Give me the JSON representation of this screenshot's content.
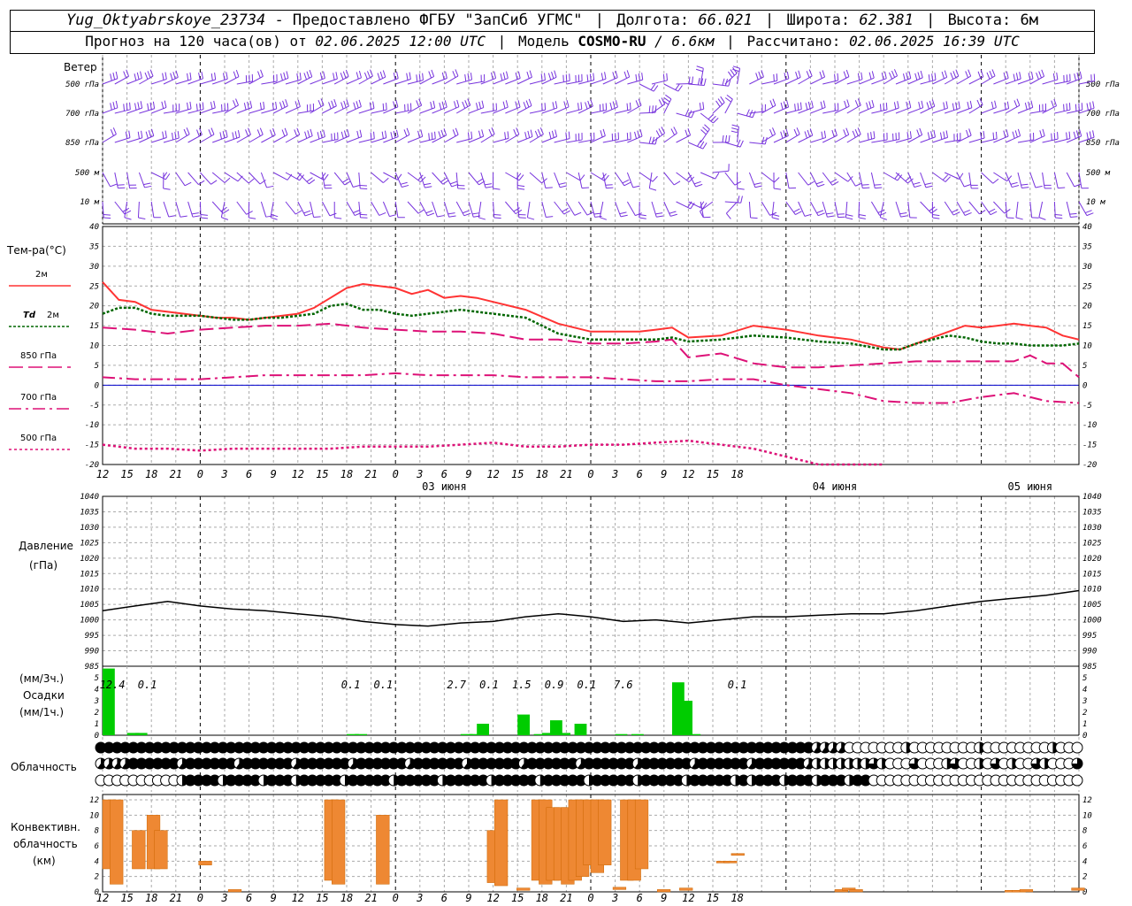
{
  "header": {
    "station": "Yug_Oktyabrskoye_23734",
    "provider": "- Предоставлено ФГБУ \"ЗапСиб УГМС\"",
    "lon_label": "Долгота:",
    "lon_value": "66.021",
    "lat_label": "Широта:",
    "lat_value": "62.381",
    "alt_label": "Высота:",
    "alt_value": "6м",
    "forecast_label": "Прогноз на 120 часа(ов) от",
    "forecast_time": "02.06.2025 12:00 UTC",
    "model_label": "Модель",
    "model_name": "COSMO-RU",
    "model_res": "/ 6.6км",
    "calc_label": "Рассчитано:",
    "calc_time": "02.06.2025 16:39 UTC"
  },
  "labels": {
    "wind": "Ветер",
    "temp": "Тем-ра(°С)",
    "t2m": "2м",
    "td": "Td",
    "td_level": "2м",
    "t850": "850 гПа",
    "t700": "700 гПа",
    "t500": "500 гПа",
    "pressure": "Давление",
    "pressure_unit": "(гПа)",
    "precip_unit3": "(мм/3ч.)",
    "precip": "Осадки",
    "precip_unit1": "(мм/1ч.)",
    "cloud": "Облачность",
    "conv1": "Конвективн.",
    "conv2": "облачность",
    "conv3": "(км)"
  },
  "colors": {
    "t2m": "#ff3333",
    "td": "#006600",
    "t850": "#dd1177",
    "t700": "#dd1177",
    "t500": "#dd1177",
    "wind": "#7733dd",
    "precip": "#00cc00",
    "conv": "#ee8833",
    "zero_line": "#0000cc"
  },
  "chart_data": [
    {
      "type": "wind_barbs",
      "levels": [
        "500 гПа",
        "700 гПа",
        "850 гПа",
        "500 м",
        "10 м"
      ],
      "x_hours": [
        0,
        120
      ]
    },
    {
      "type": "line",
      "ylabel": "Тем-ра(°С)",
      "ylim": [
        -20,
        40
      ],
      "yticks": [
        -20,
        -15,
        -10,
        -5,
        0,
        5,
        10,
        15,
        20,
        25,
        30,
        35,
        40
      ],
      "x_hour_ticks": [
        "12",
        "15",
        "18",
        "21",
        "0",
        "3",
        "6",
        "9",
        "12",
        "15",
        "18",
        "21",
        "0",
        "3",
        "6",
        "9",
        "12",
        "15",
        "18",
        "21",
        "0",
        "3",
        "6",
        "9",
        "12",
        "15",
        "18"
      ],
      "date_labels": [
        "03 июня",
        "04 июня",
        "05 июня"
      ],
      "series": [
        {
          "name": "2м",
          "x": [
            0,
            2,
            4,
            6,
            8,
            10,
            12,
            14,
            16,
            18,
            20,
            22,
            24,
            26,
            28,
            30,
            32,
            34,
            36,
            38,
            40,
            42,
            44,
            46,
            48,
            52,
            56,
            60,
            64,
            66,
            68,
            70,
            72,
            76,
            80,
            84,
            88,
            92,
            96,
            98,
            100,
            102,
            104,
            106,
            108,
            110,
            112,
            114,
            116,
            118,
            120
          ],
          "values": [
            26,
            21.5,
            21,
            19,
            18.5,
            18,
            17.5,
            17,
            17,
            16.5,
            17,
            17.5,
            18,
            19.5,
            22,
            24.5,
            25.5,
            25,
            24.5,
            23,
            24,
            22,
            22.5,
            22,
            21,
            19,
            15.5,
            13.5,
            13.5,
            13.5,
            14,
            14.5,
            12,
            12.5,
            15,
            14,
            12.5,
            11.5,
            9.5,
            9,
            10.5,
            12,
            13.5,
            15,
            14.5,
            15,
            15.5,
            15,
            14.5,
            12.5,
            11.5
          ]
        },
        {
          "name": "Td 2м",
          "x": [
            0,
            2,
            4,
            6,
            8,
            10,
            12,
            14,
            16,
            18,
            20,
            22,
            24,
            26,
            28,
            30,
            32,
            34,
            36,
            38,
            40,
            42,
            44,
            46,
            48,
            52,
            56,
            60,
            64,
            66,
            68,
            70,
            72,
            76,
            80,
            84,
            88,
            92,
            96,
            98,
            100,
            102,
            104,
            106,
            108,
            110,
            112,
            114,
            116,
            118,
            120
          ],
          "values": [
            18,
            19.5,
            19.5,
            18,
            17.5,
            17.5,
            17.5,
            17,
            16.5,
            16.5,
            17,
            17,
            17.5,
            18,
            20,
            20.5,
            19,
            19,
            18,
            17.5,
            18,
            18.5,
            19,
            18.5,
            18,
            17,
            13,
            11.5,
            11.5,
            11.5,
            11.5,
            12,
            11,
            11.5,
            12.5,
            12,
            11,
            10.5,
            9,
            9,
            10.5,
            11.5,
            12.5,
            12,
            11,
            10.5,
            10.5,
            10,
            10,
            10,
            10.5
          ]
        },
        {
          "name": "850 гПа",
          "x": [
            0,
            4,
            8,
            12,
            16,
            20,
            24,
            28,
            32,
            36,
            40,
            44,
            48,
            52,
            56,
            60,
            64,
            68,
            70,
            72,
            76,
            80,
            84,
            88,
            92,
            96,
            100,
            104,
            108,
            112,
            114,
            116,
            118,
            120
          ],
          "values": [
            14.5,
            14,
            13,
            14,
            14.5,
            15,
            15,
            15.5,
            14.5,
            14,
            13.5,
            13.5,
            13,
            11.5,
            11.5,
            10.5,
            10.5,
            11,
            11.5,
            7,
            8,
            5.5,
            4.5,
            4.5,
            5,
            5.5,
            6,
            6,
            6,
            6,
            7.5,
            5.5,
            5.5,
            2
          ]
        },
        {
          "name": "700 гПа",
          "x": [
            0,
            4,
            8,
            12,
            16,
            20,
            24,
            28,
            32,
            36,
            40,
            44,
            48,
            52,
            56,
            60,
            64,
            68,
            72,
            76,
            80,
            84,
            88,
            92,
            96,
            100,
            104,
            108,
            112,
            116,
            120
          ],
          "values": [
            2,
            1.5,
            1.5,
            1.5,
            2,
            2.5,
            2.5,
            2.5,
            2.5,
            3,
            2.5,
            2.5,
            2.5,
            2,
            2,
            2,
            1.5,
            1,
            1,
            1.5,
            1.5,
            0,
            -1,
            -2,
            -4,
            -4.5,
            -4.5,
            -3,
            -2,
            -4,
            -4.5
          ]
        },
        {
          "name": "500 гПа",
          "x": [
            0,
            4,
            8,
            12,
            16,
            20,
            24,
            28,
            32,
            36,
            40,
            44,
            48,
            52,
            56,
            60,
            64,
            68,
            72,
            76,
            80,
            84,
            88,
            92,
            96
          ],
          "values": [
            -15,
            -16,
            -16,
            -16.5,
            -16,
            -16,
            -16,
            -16,
            -15.5,
            -15.5,
            -15.5,
            -15,
            -14.5,
            -15.5,
            -15.5,
            -15,
            -15,
            -14.5,
            -14,
            -15,
            -16,
            -18,
            -20,
            -22,
            -24
          ]
        }
      ]
    },
    {
      "type": "line",
      "ylabel": "Давление",
      "ylim": [
        985,
        1040
      ],
      "yticks": [
        985,
        990,
        995,
        1000,
        1005,
        1010,
        1015,
        1020,
        1025,
        1030,
        1035,
        1040
      ],
      "series": [
        {
          "name": "Давление",
          "x": [
            0,
            4,
            8,
            12,
            16,
            20,
            24,
            28,
            32,
            36,
            40,
            44,
            48,
            52,
            56,
            60,
            64,
            68,
            72,
            76,
            80,
            84,
            88,
            92,
            96,
            100,
            104,
            108,
            112,
            116,
            120
          ],
          "values": [
            1003,
            1004.5,
            1006,
            1004.5,
            1003.5,
            1003,
            1002,
            1001,
            999.5,
            998.5,
            998,
            999,
            999.5,
            1001,
            1002,
            1001,
            999.5,
            1000,
            999,
            1000,
            1001,
            1001,
            1001.5,
            1002,
            1002,
            1003,
            1004.5,
            1006,
            1007,
            1008,
            1009.5
          ]
        }
      ]
    },
    {
      "type": "bar",
      "ylabel": "Осадки",
      "ylim": [
        0,
        5
      ],
      "yticks": [
        0,
        1,
        2,
        3,
        4,
        5
      ],
      "x": [
        0,
        3,
        4,
        30,
        31,
        44,
        45,
        46,
        51,
        53,
        54,
        55,
        56,
        58,
        63,
        65,
        70,
        71,
        72
      ],
      "values": [
        5.8,
        0.2,
        0.2,
        0.1,
        0.1,
        0.1,
        0.1,
        1,
        1.8,
        0.1,
        0.2,
        1.3,
        0.2,
        1,
        0.1,
        0.1,
        4.6,
        3,
        0.1
      ],
      "labels": [
        "12.4",
        "0.1",
        "0.1",
        "0.1",
        "2.7",
        "0.1",
        "1.5",
        "0.9",
        "0.1",
        "7.6",
        "0.1"
      ]
    },
    {
      "type": "bar",
      "ylabel": "Конвективн. облачность",
      "ylim": [
        0,
        12
      ],
      "yticks": [
        0,
        2,
        4,
        6,
        8,
        10,
        12
      ],
      "x": [
        0,
        1,
        4,
        6,
        7,
        13,
        17,
        30,
        31,
        37,
        52,
        53,
        56,
        58,
        59,
        60,
        61,
        62,
        63,
        64,
        65,
        66,
        67,
        69,
        70,
        71,
        72,
        75,
        78,
        83,
        84,
        85,
        99,
        100,
        101,
        122,
        123,
        124,
        131
      ],
      "values": [
        12,
        12,
        8,
        10,
        8,
        4,
        0.3,
        12,
        12,
        10,
        8,
        12,
        0.5,
        12,
        12,
        11,
        11,
        11,
        12,
        12,
        12,
        12,
        12,
        0.6,
        12,
        12,
        12,
        0.3,
        0.5,
        4,
        4,
        5,
        0.3,
        0.5,
        0.3,
        0.2,
        0.2,
        0.3,
        0.5
      ]
    }
  ]
}
